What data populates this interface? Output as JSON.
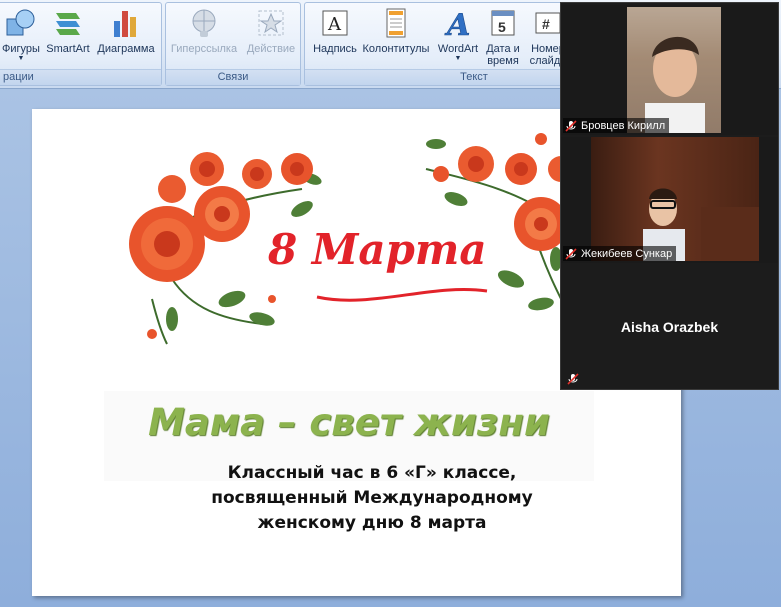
{
  "ribbon": {
    "groups": [
      {
        "label": "рации"
      },
      {
        "label": "Связи"
      },
      {
        "label": "Текст"
      }
    ],
    "buttons": {
      "shapes": "Фигуры",
      "smartart": "SmartArt",
      "chart": "Диаграмма",
      "hyperlink": "Гиперссылка",
      "action": "Действие",
      "textbox": "Надпись",
      "header_footer": "Колонтитулы",
      "wordart": "WordArt",
      "datetime_l1": "Дата и",
      "datetime_l2": "время",
      "slidenum_l1": "Номер",
      "slidenum_l2": "слайда"
    },
    "datetime_icon_digit": "5",
    "slidenum_icon_glyph": "#"
  },
  "slide": {
    "march_title": "8 Марта",
    "headline": "Мама – свет жизни",
    "subtitle_lines": [
      "Классный час в 6 «Г» классе,",
      "посвященный Международному",
      "женскому дню 8 марта"
    ]
  },
  "zoom": {
    "participants": [
      {
        "name": "Бровцев Кирилл",
        "muted": true
      },
      {
        "name": "Жекибеев Сункар",
        "muted": true
      },
      {
        "name": "Aisha Orazbek",
        "muted": true
      }
    ]
  },
  "colors": {
    "march_red": "#e2232a",
    "headline_green": "#8cb34e",
    "ribbon_bg": "#dde8f6",
    "workspace_bg": "#9db8df",
    "zoom_bg": "#1c1c1c",
    "muted_red": "#e0302a"
  },
  "icons": {
    "shapes": "shapes-icon",
    "smartart": "smartart-icon",
    "chart": "bar-chart-icon",
    "hyperlink": "globe-link-icon",
    "action": "action-star-icon",
    "textbox": "textbox-icon",
    "header_footer": "document-icon",
    "wordart": "wordart-a-icon",
    "datetime": "calendar-icon",
    "slidenum": "slide-number-icon",
    "mute": "mic-muted-icon"
  }
}
